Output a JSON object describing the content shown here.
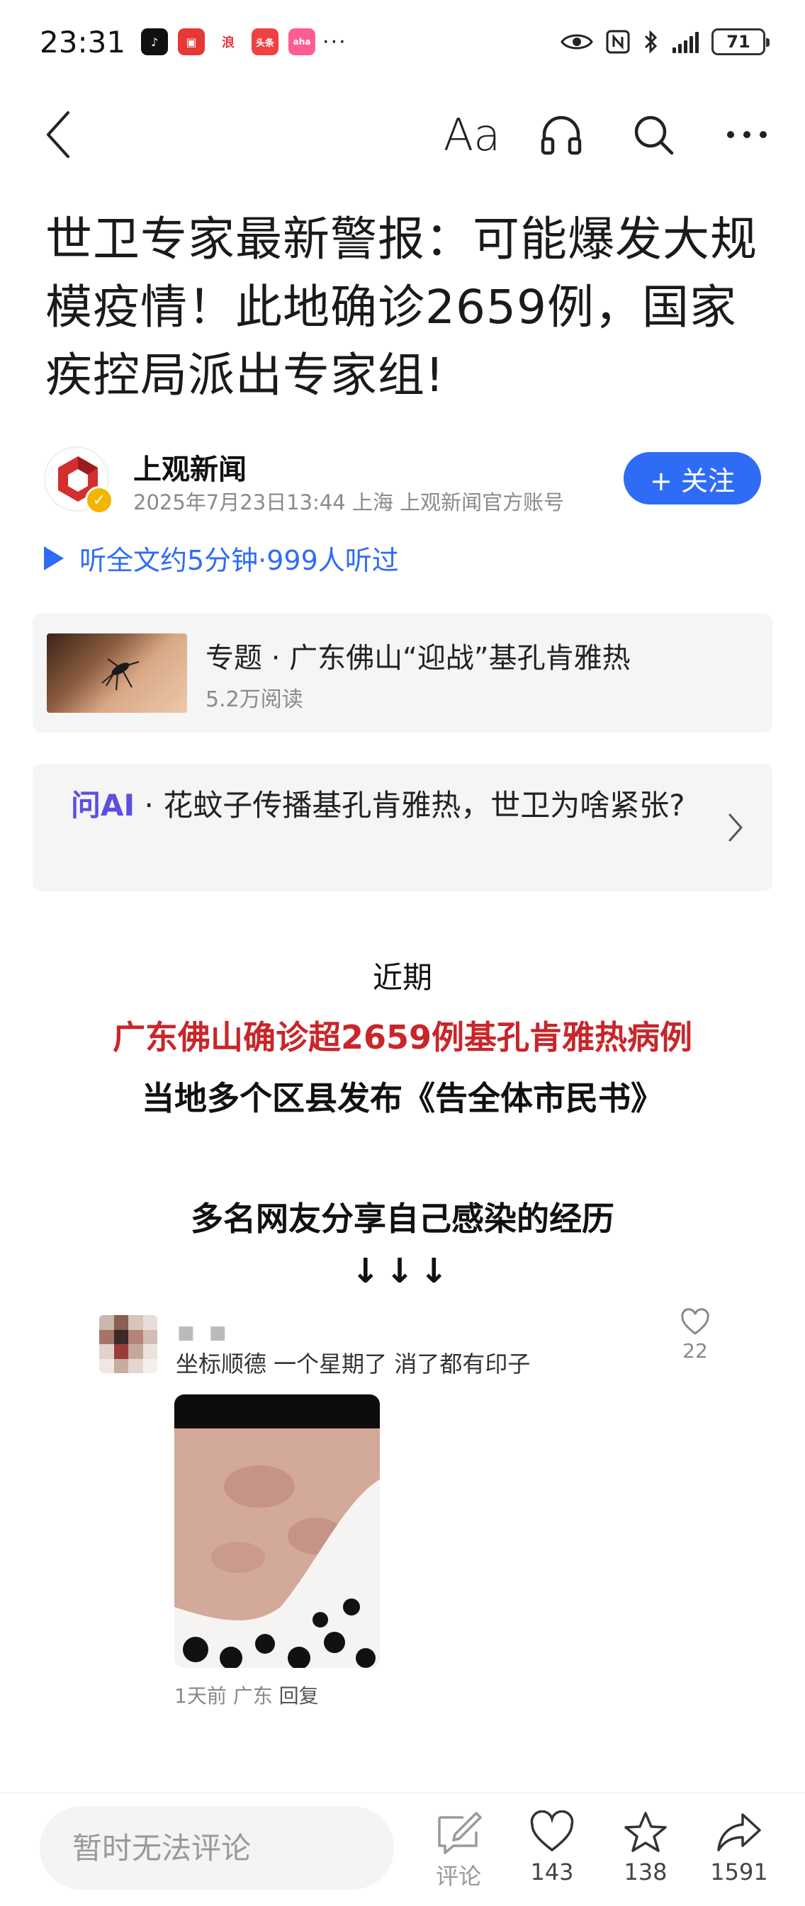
{
  "status_bar": {
    "time": "23:31",
    "apps": [
      {
        "name": "douyin-app-icon",
        "glyph": "♪",
        "color": "#111111"
      },
      {
        "name": "red-app-icon",
        "glyph": "▣",
        "color": "#e53935"
      },
      {
        "name": "sina-app-icon",
        "glyph": "浪",
        "color": "#e4393c"
      },
      {
        "name": "toutiao-app-icon",
        "glyph": "头条",
        "color": "#f04142"
      },
      {
        "name": "pink-app-icon",
        "glyph": "aha",
        "color": "#ff5c93"
      }
    ],
    "more": "···",
    "battery": "71"
  },
  "toolbar": {
    "font_label": "Aa"
  },
  "article": {
    "title": "世卫专家最新警报：可能爆发大规模疫情！此地确诊2659例，国家疾控局派出专家组!",
    "author": {
      "name": "上观新闻",
      "meta": "2025年7月23日13:44 上海 上观新闻官方账号",
      "follow_label": "+ 关注"
    },
    "listen": "听全文约5分钟·999人听过",
    "topic": {
      "title": "专题 · 广东佛山“迎战”基孔肯雅热",
      "reads": "5.2万阅读"
    },
    "ask_ai": {
      "tag": "问AI",
      "text": " · 花蚊子传播基孔肯雅热，世卫为啥紧张?"
    },
    "body": {
      "line1": "近期",
      "line2": "广东佛山确诊超2659例基孔肯雅热病例",
      "line3": "当地多个区县发布《告全体市民书》",
      "line4": "多名网友分享自己感染的经历",
      "arrows": "↓↓↓"
    },
    "embedded_comment": {
      "name": "■ ■",
      "text": "坐标顺德 一个星期了 消了都有印子",
      "likes": "22",
      "meta_time_loc": "1天前 广东 ",
      "reply": "回复"
    }
  },
  "bottom_bar": {
    "comment_placeholder": "暂时无法评论",
    "comment_label": "评论",
    "likes": "143",
    "favorites": "138",
    "shares": "1591"
  },
  "colors": {
    "accent_blue": "#2f6cf6",
    "headline_red": "#c8262a",
    "ai_purple": "#5b4fe0"
  }
}
